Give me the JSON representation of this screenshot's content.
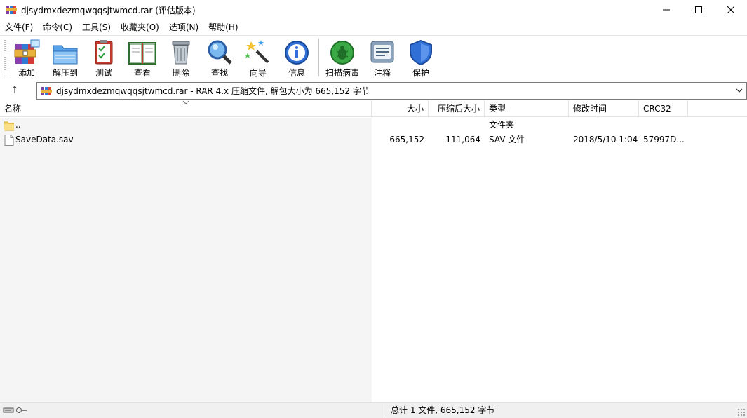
{
  "window": {
    "title": "djsydmxdezmqwqqsjtwmcd.rar (评估版本)",
    "controls": {
      "minimize": "—",
      "maximize": "☐",
      "close": "✕"
    }
  },
  "menu": [
    "文件(F)",
    "命令(C)",
    "工具(S)",
    "收藏夹(O)",
    "选项(N)",
    "帮助(H)"
  ],
  "toolbar": [
    {
      "label": "添加",
      "icon": "add-archive-icon"
    },
    {
      "label": "解压到",
      "icon": "extract-to-icon"
    },
    {
      "label": "测试",
      "icon": "test-icon"
    },
    {
      "label": "查看",
      "icon": "view-icon"
    },
    {
      "label": "删除",
      "icon": "delete-icon"
    },
    {
      "label": "查找",
      "icon": "find-icon"
    },
    {
      "label": "向导",
      "icon": "wizard-icon"
    },
    {
      "label": "信息",
      "icon": "info-icon"
    },
    {
      "label": "扫描病毒",
      "icon": "scan-virus-icon"
    },
    {
      "label": "注释",
      "icon": "comment-icon"
    },
    {
      "label": "保护",
      "icon": "protect-icon"
    }
  ],
  "path": {
    "up_glyph": "↑",
    "text": "djsydmxdezmqwqqsjtwmcd.rar - RAR 4.x 压缩文件, 解包大小为 665,152 字节"
  },
  "columns": [
    "名称",
    "大小",
    "压缩后大小",
    "类型",
    "修改时间",
    "CRC32"
  ],
  "rows": [
    {
      "name": "..",
      "size": "",
      "packed": "",
      "type": "文件夹",
      "modified": "",
      "crc": "",
      "icon": "folder-icon"
    },
    {
      "name": "SaveData.sav",
      "size": "665,152",
      "packed": "111,064",
      "type": "SAV 文件",
      "modified": "2018/5/10 1:04",
      "crc": "57997D...",
      "icon": "file-icon"
    }
  ],
  "status": {
    "text": "总计 1 文件, 665,152 字节"
  },
  "colors": {
    "list_name_bg": "#f5f5f5",
    "accent_blue": "#2f6fd6"
  }
}
